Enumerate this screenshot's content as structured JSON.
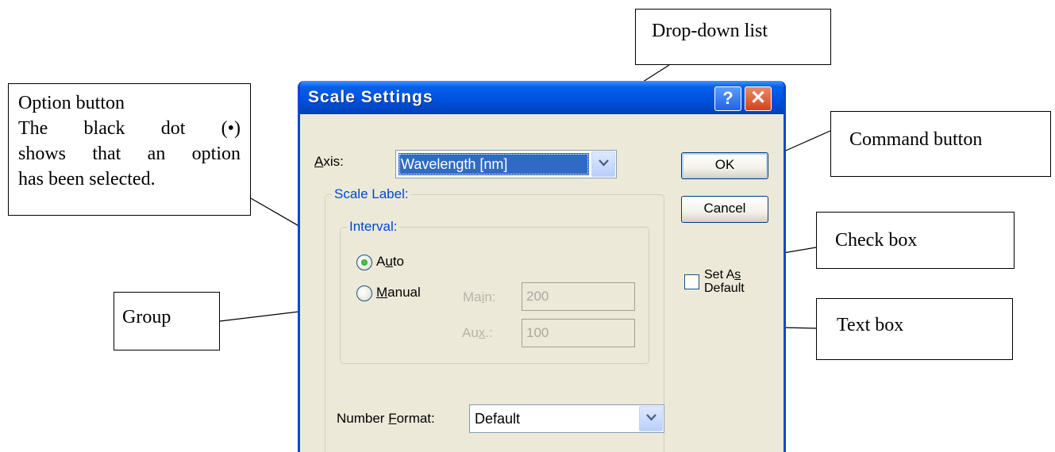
{
  "callouts": {
    "option_button": {
      "title": "Option button",
      "line1": "The black dot (•)",
      "line2": "shows that an option",
      "line3": "has been selected."
    },
    "dropdown": "Drop-down list",
    "command": "Command button",
    "checkbox": "Check box",
    "group": "Group",
    "textbox": "Text box"
  },
  "dialog": {
    "title": "Scale Settings",
    "help_button": "?",
    "close_button": "✕",
    "axis_label": "Axis:",
    "axis_value": "Wavelength [nm]",
    "ok_button": "OK",
    "cancel_button": "Cancel",
    "scale_label_group": "Scale Label:",
    "interval_group": "Interval:",
    "auto_option": "Auto",
    "manual_option": "Manual",
    "main_label": "Main:",
    "main_value": "200",
    "aux_label": "Aux.:",
    "aux_value": "100",
    "set_default_line1": "Set As",
    "set_default_line2": "Default",
    "number_format_label": "Number Format:",
    "number_format_value": "Default",
    "selected_interval": "Auto",
    "set_as_default_checked": false
  },
  "colors": {
    "titlebar": "#0054e3",
    "dialog_bg": "#ece9d8",
    "group_title": "#0046d5",
    "selection": "#316ac5"
  }
}
